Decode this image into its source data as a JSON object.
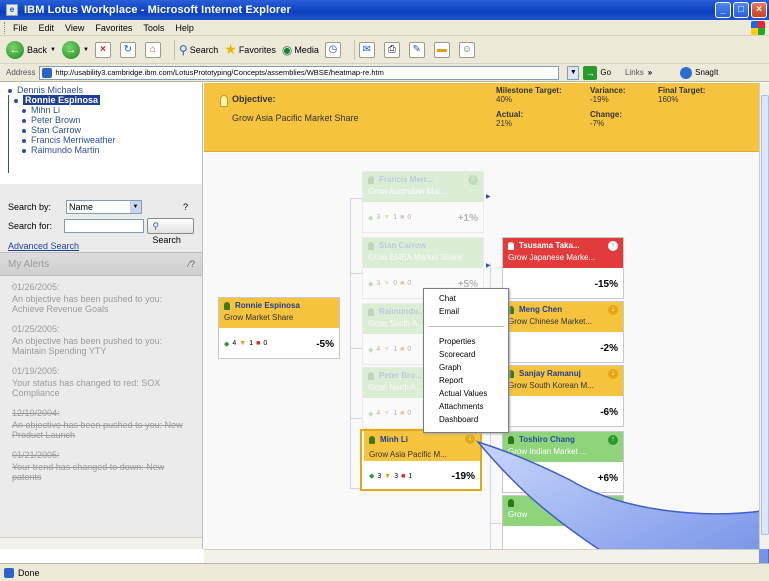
{
  "window": {
    "title": "IBM Lotus Workplace - Microsoft Internet Explorer"
  },
  "menu": [
    "File",
    "Edit",
    "View",
    "Favorites",
    "Tools",
    "Help"
  ],
  "toolbar": {
    "back": "Back",
    "search": "Search",
    "favorites": "Favorites",
    "media": "Media"
  },
  "address": {
    "label": "Address",
    "url": "http://usability3.cambridge.ibm.com/LotusPrototyping/Concepts/assemblies/WBSE/heatmap-re.htm",
    "go": "Go",
    "links": "Links",
    "snagit": "SnagIt"
  },
  "tree": {
    "root": "Dennis Michaels",
    "selected": "Ronnie Espinosa",
    "children": [
      "Mihn Li",
      "Peter Brown",
      "Stan Carrow",
      "Francis Merriweather",
      "Raimundo Martin"
    ]
  },
  "search": {
    "by_label": "Search by:",
    "by_value": "Name",
    "help": "?",
    "for_label": "Search for:",
    "button": "Search",
    "advanced": "Advanced Search"
  },
  "alerts": {
    "title": "My Alerts",
    "items": [
      {
        "date": "01/26/2005:",
        "text": "An objective has been pushed to you: Achieve Revenue Goals",
        "struck": false
      },
      {
        "date": "01/25/2005:",
        "text": "An objective has been pushed to you: Maintain Spending YTY",
        "struck": false
      },
      {
        "date": "01/19/2005:",
        "text": "Your status has changed to red: SOX Compliance",
        "struck": false
      },
      {
        "date": "12/10/2004:",
        "text": "An objective has been pushed to you: New Product Launch",
        "struck": true
      },
      {
        "date": "01/21/2005:",
        "text": "Your trend has changed to down: New patents",
        "struck": true
      }
    ]
  },
  "banner": {
    "objective_label": "Objective:",
    "objective": "Grow Asia Pacific Market Share",
    "milestone_label": "Milestone Target:",
    "milestone": "40%",
    "variance_label": "Variance:",
    "variance": "-19%",
    "final_label": "Final Target:",
    "final": "160%",
    "actual_label": "Actual:",
    "actual": "21%",
    "change_label": "Change:",
    "change": "-7%"
  },
  "cards": [
    {
      "id": "ronnie",
      "name": "Ronnie Espinosa",
      "objective": "Grow Market Share",
      "g": "4",
      "y": "1",
      "r": "0",
      "pct": "-5%"
    },
    {
      "id": "francis",
      "name": "Francis Merr...",
      "objective": "Grow Australian Mar...",
      "g": "3",
      "y": "1",
      "r": "0",
      "pct": "+1%"
    },
    {
      "id": "stan",
      "name": "Stan Carrow",
      "objective": "Grow EMEA Market Share",
      "g": "3",
      "y": "0",
      "r": "0",
      "pct": "+5%"
    },
    {
      "id": "raimundo",
      "name": "Raimundo...",
      "objective": "Grow South A...",
      "g": "4",
      "y": "1",
      "r": "0",
      "pct": ""
    },
    {
      "id": "peter",
      "name": "Peter Bro...",
      "objective": "Grow North A...",
      "g": "4",
      "y": "1",
      "r": "0",
      "pct": ""
    },
    {
      "id": "minh",
      "name": "Minh Li",
      "objective": "Grow Asia Pacific M...",
      "g": "3",
      "y": "3",
      "r": "1",
      "pct": "-19%"
    },
    {
      "id": "tsusama",
      "name": "Tsusama Taka...",
      "objective": "Grow Japanese Marke...",
      "g": "",
      "y": "",
      "r": "",
      "pct": "-15%"
    },
    {
      "id": "meng",
      "name": "Meng Chen",
      "objective": "Grow Chinese Market...",
      "g": "",
      "y": "",
      "r": "",
      "pct": "-2%"
    },
    {
      "id": "sanjay",
      "name": "Sanjay Ramanuj",
      "objective": "Grow South Korean M...",
      "g": "",
      "y": "",
      "r": "",
      "pct": "-6%"
    },
    {
      "id": "toshiro",
      "name": "Toshiro Chang",
      "objective": "Grow Indian Market ...",
      "g": "",
      "y": "",
      "r": "",
      "pct": "+6%"
    },
    {
      "id": "extra",
      "name": "",
      "objective": "Grow",
      "g": "",
      "y": "",
      "r": "",
      "pct": ""
    }
  ],
  "context_menu": {
    "group1": [
      "Chat",
      "Email"
    ],
    "group2": [
      "Properties",
      "Scorecard",
      "Graph",
      "Report",
      "Actual Values",
      "Attachments",
      "Dashboard"
    ]
  },
  "status": {
    "text": "Done"
  },
  "colors": {
    "banner": "#f5c33d",
    "red": "#e23b3b",
    "green": "#8fd37a",
    "callout": "#8ea6f0"
  }
}
